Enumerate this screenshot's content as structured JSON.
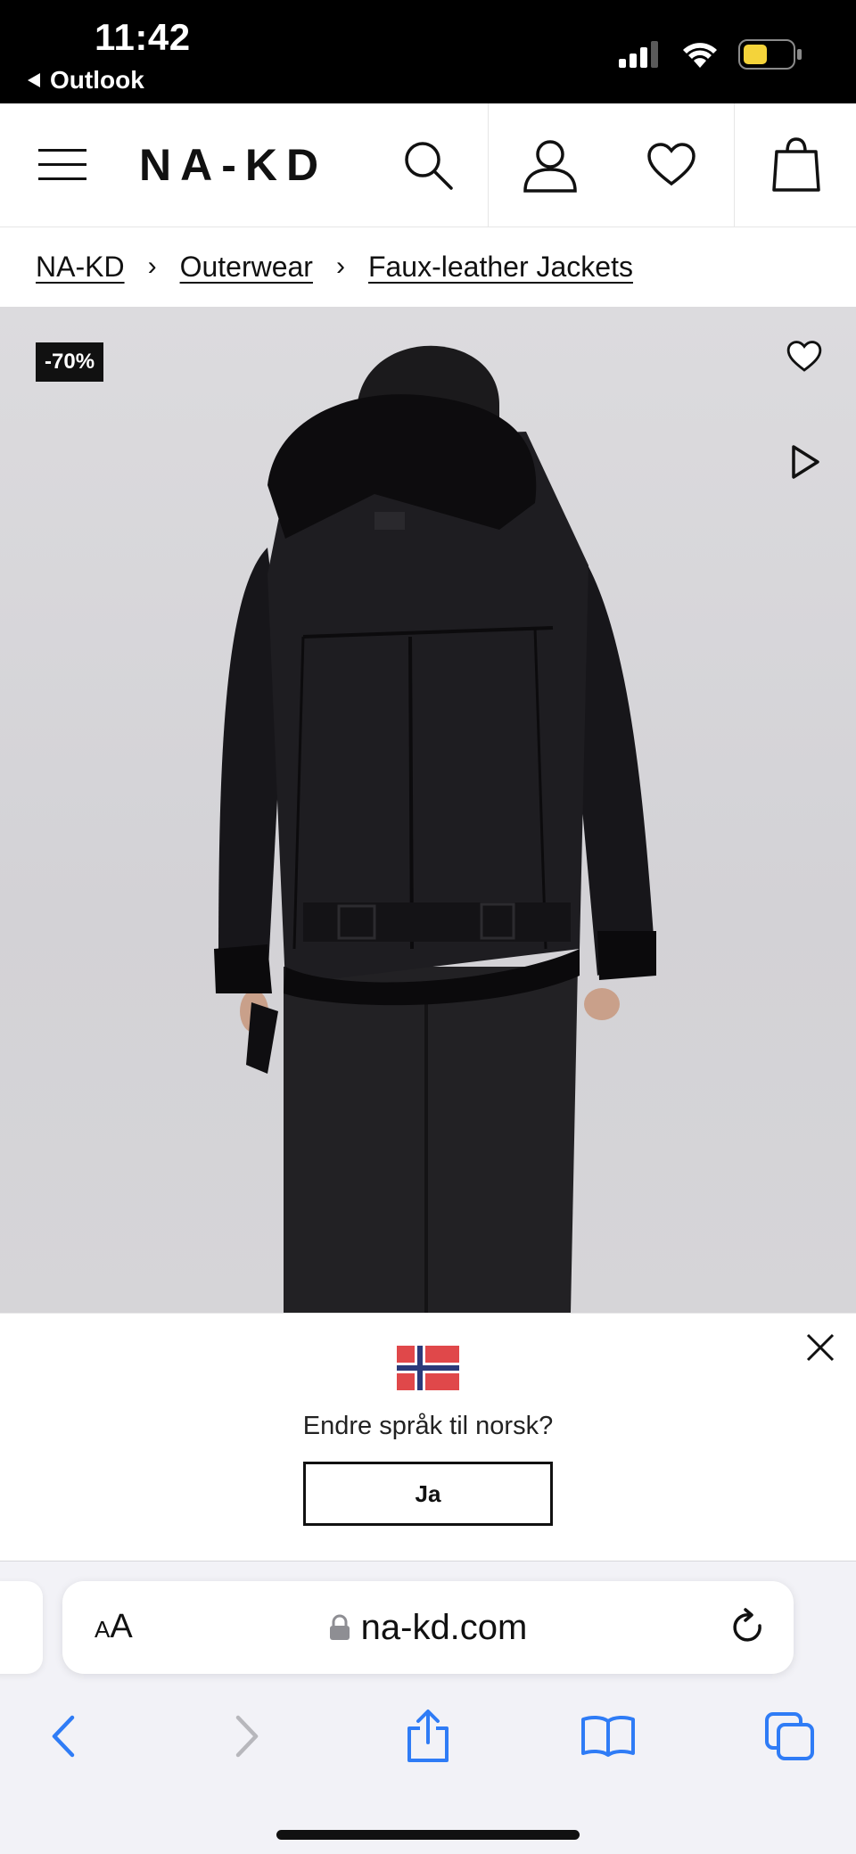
{
  "status_bar": {
    "time": "11:42",
    "back_app": "Outlook",
    "icons": [
      "signal-icon",
      "wifi-icon",
      "battery-icon"
    ]
  },
  "header": {
    "logo": "NA-KD",
    "icons": [
      "menu-icon",
      "search-icon",
      "account-icon",
      "wishlist-icon",
      "bag-icon"
    ]
  },
  "breadcrumb": {
    "items": [
      "NA-KD",
      "Outerwear",
      "Faux-leather Jackets"
    ],
    "separator": "›"
  },
  "product": {
    "discount_badge": "-70%",
    "icons": [
      "heart-icon",
      "play-icon"
    ]
  },
  "language_prompt": {
    "question": "Endre språk til norsk?",
    "confirm_label": "Ja",
    "flag": "norway-flag"
  },
  "browser": {
    "text_size_label_small": "A",
    "text_size_label_big": "A",
    "url": "na-kd.com",
    "toolbar_icons": [
      "back-icon",
      "forward-icon",
      "share-icon",
      "bookmarks-icon",
      "tabs-icon"
    ]
  },
  "colors": {
    "status_bar_bg": "#000000",
    "badge_bg": "#111111",
    "flag_red": "#e0484a",
    "flag_blue": "#2b3a7a",
    "ios_blue": "#2f7cf6"
  }
}
